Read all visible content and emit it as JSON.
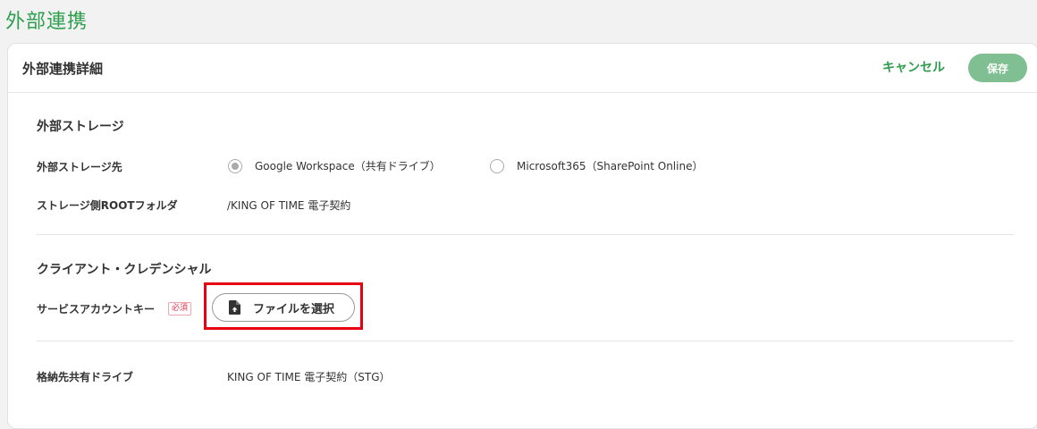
{
  "page": {
    "title": "外部連携"
  },
  "card": {
    "title": "外部連携詳細",
    "cancel_label": "キャンセル",
    "save_label": "保存"
  },
  "storage_section": {
    "title": "外部ストレージ",
    "destination_label": "外部ストレージ先",
    "options": [
      {
        "label": "Google Workspace（共有ドライブ）",
        "selected": true
      },
      {
        "label": "Microsoft365（SharePoint Online）",
        "selected": false
      }
    ],
    "root_folder_label": "ストレージ側ROOTフォルダ",
    "root_folder_value": "/KING OF TIME 電子契約"
  },
  "credential_section": {
    "title": "クライアント・クレデンシャル",
    "service_key_label": "サービスアカウントキー",
    "required_badge": "必須",
    "file_button_label": "ファイルを選択",
    "file_button_icon": "file-upload-icon"
  },
  "shared_drive": {
    "label": "格納先共有ドライブ",
    "value": "KING OF TIME 電子契約（STG）"
  },
  "colors": {
    "accent": "#2e9e4f",
    "save_button": "#7fbf91",
    "highlight": "#e60012",
    "required": "#e0334a"
  }
}
